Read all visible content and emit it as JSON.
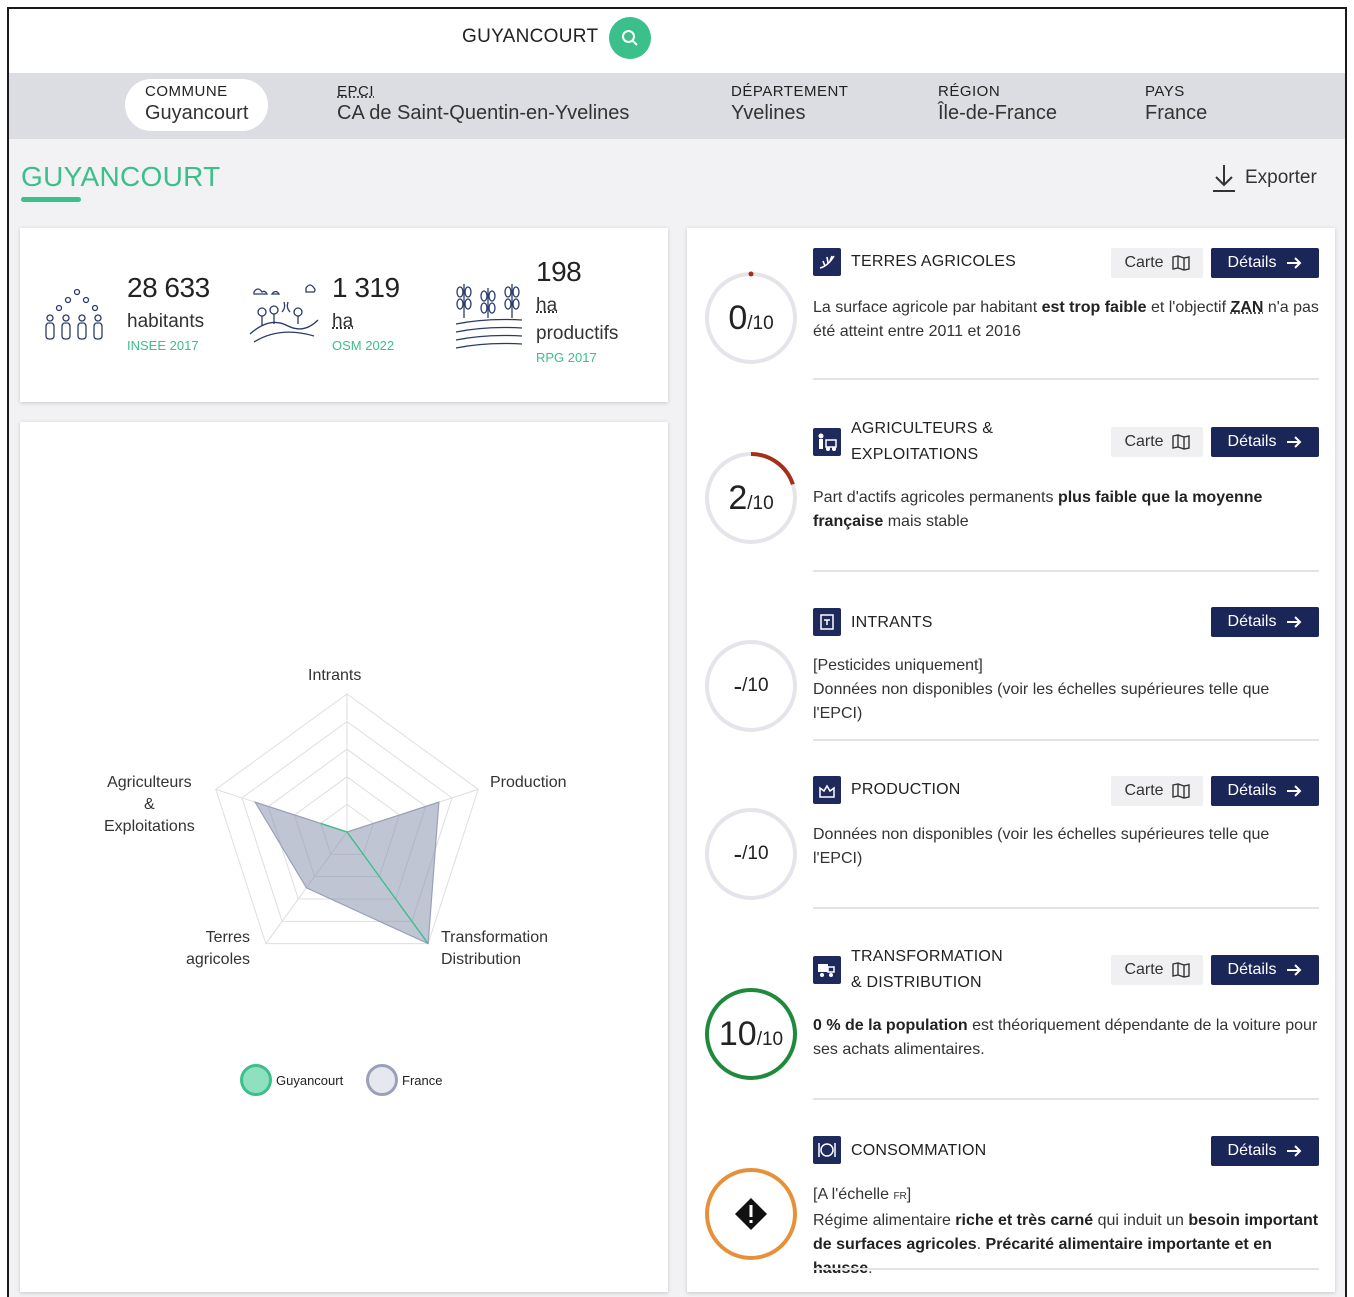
{
  "search": {
    "value": "GUYANCOURT"
  },
  "scales": [
    {
      "label": "COMMUNE",
      "value": "Guyancourt"
    },
    {
      "label": "EPCI",
      "value": "CA de Saint-Quentin-en-Yvelines"
    },
    {
      "label": "DÉPARTEMENT",
      "value": "Yvelines"
    },
    {
      "label": "RÉGION",
      "value": "Île-de-France"
    },
    {
      "label": "PAYS",
      "value": "France"
    }
  ],
  "page": {
    "title": "GUYANCOURT",
    "export_label": "Exporter"
  },
  "stats": [
    {
      "value": "28 633",
      "unit": "habitants",
      "source": "INSEE 2017"
    },
    {
      "value": "1 319",
      "unit": "ha",
      "source": "OSM 2022"
    },
    {
      "value": "198",
      "unit": "ha",
      "unit2": "productifs",
      "source": "RPG 2017"
    }
  ],
  "radar": {
    "axes": [
      "Intrants",
      "Production",
      "Transformation Distribution",
      "Terres agricoles",
      "Agriculteurs & Exploitations"
    ],
    "labels": {
      "intrants": "Intrants",
      "production": "Production",
      "transfo_1": "Transformation",
      "transfo_2": "Distribution",
      "terres_1": "Terres",
      "terres_2": "agricoles",
      "agri_1": "Agriculteurs",
      "agri_2": "&",
      "agri_3": "Exploitations"
    },
    "series": [
      {
        "name": "Guyancourt",
        "values": [
          0,
          0,
          10,
          0,
          2
        ],
        "color": "#3bbf8b"
      },
      {
        "name": "France",
        "values": [
          0,
          7,
          10,
          5,
          7
        ],
        "color": "#9aa0b8"
      }
    ],
    "max": 10
  },
  "categories": [
    {
      "title": "TERRES AGRICOLES",
      "score": "0",
      "denom": "/10",
      "ring_value": 0,
      "ring_color": "#a33018",
      "has_carte": true,
      "text_parts": [
        "La surface agricole par habitant ",
        "est trop faible",
        " et l'objectif ",
        "ZAN",
        " n'a pas été atteint entre 2011 et 2016"
      ]
    },
    {
      "title_1": "AGRICULTEURS &",
      "title_2": "EXPLOITATIONS",
      "score": "2",
      "denom": "/10",
      "ring_value": 2,
      "ring_color": "#a33018",
      "has_carte": true,
      "text_parts": [
        "Part d'actifs agricoles permanents ",
        "plus faible que la moyenne française",
        " mais stable"
      ]
    },
    {
      "title": "INTRANTS",
      "score": "-",
      "denom": "/10",
      "has_carte": false,
      "text_1": "[Pesticides uniquement]",
      "text_2": "Données non disponibles (voir les échelles supérieures telle que l'EPCI)"
    },
    {
      "title": "PRODUCTION",
      "score": "-",
      "denom": "/10",
      "has_carte": true,
      "text_1": "Données non disponibles (voir les échelles supérieures telle que l'EPCI)"
    },
    {
      "title_1": "TRANSFORMATION",
      "title_2": "& DISTRIBUTION",
      "score": "10",
      "denom": "/10",
      "ring_value": 10,
      "ring_color": "#1e8a3a",
      "has_carte": true,
      "text_parts": [
        "0 % de la population",
        " est théoriquement dépendante de la voiture pour ses achats alimentaires."
      ]
    },
    {
      "title": "CONSOMMATION",
      "ring_color": "#e6913a",
      "has_carte": false,
      "text_1a": "[A l'échelle ",
      "text_1b": "FR",
      "text_1c": "]",
      "text_parts": [
        "Régime alimentaire ",
        "riche et très carné",
        " qui induit un ",
        "besoin important de surfaces agricoles",
        ". ",
        "Précarité alimentaire importante et en hausse",
        "."
      ]
    }
  ],
  "buttons": {
    "carte": "Carte",
    "details": "Détails"
  },
  "colors": {
    "accent": "#3bbf8b",
    "navy": "#1a2558"
  }
}
